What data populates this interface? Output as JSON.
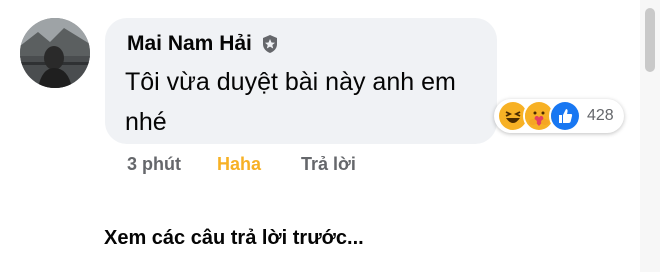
{
  "comment": {
    "author": "Mai Nam Hải",
    "text": "Tôi vừa duyệt bài này anh em nhé",
    "reaction_count": "428",
    "reaction_icons": [
      "haha-icon",
      "care-icon",
      "like-icon"
    ],
    "time": "3 phút",
    "reaction_label": "Haha",
    "reply_label": "Trả lời"
  },
  "view_previous_replies": "Xem các câu trả lời trước...",
  "colors": {
    "bubble": "#f0f2f5",
    "haha_accent": "#f7b125",
    "like_blue": "#1877f2",
    "secondary_text": "#65676b"
  }
}
